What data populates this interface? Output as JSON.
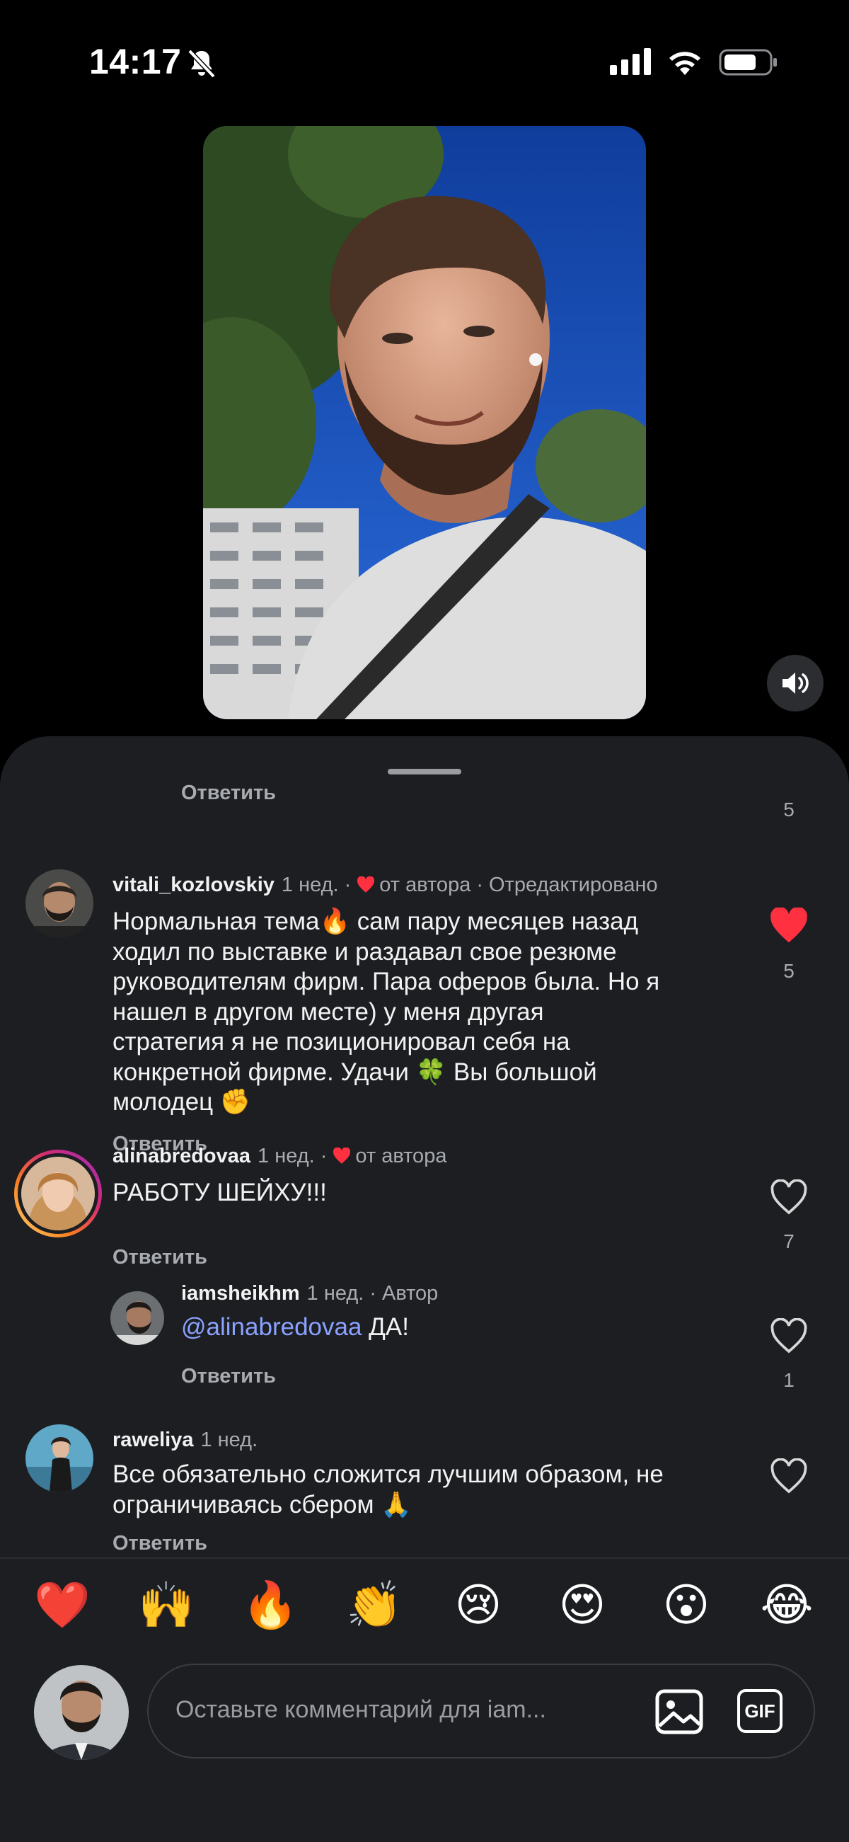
{
  "status_bar": {
    "time": "14:17"
  },
  "partial_comment": {
    "reply_label": "Ответить",
    "like_count": "5"
  },
  "comments": [
    {
      "username": "vitali_kozlovskiy",
      "time": "1 нед.",
      "liked_by_author": "от автора",
      "edited": "Отредактировано",
      "text_lines": [
        "Нормальная тема🔥 сам пару месяцев назад",
        "ходил по выставке и раздавал свое резюме",
        "руководителям фирм. Пара оферов была. Но я",
        "нашел в другом месте) у меня другая",
        "стратегия я не позиционировал себя на",
        "конкретной фирме. Удачи 🍀 Вы большой",
        "молодец ✊"
      ],
      "reply_label": "Ответить",
      "like_count": "5",
      "liked": true
    },
    {
      "username": "alinabredovaa",
      "time": "1 нед.",
      "liked_by_author": "от автора",
      "text": "РАБОТУ ШЕЙХУ!!!",
      "reply_label": "Ответить",
      "like_count": "7",
      "liked": false
    },
    {
      "username": "iamsheikhm",
      "time": "1 нед.",
      "author_badge": "Автор",
      "mention": "@alinabredovaa",
      "text": " ДА!",
      "reply_label": "Ответить",
      "like_count": "1",
      "liked": false
    },
    {
      "username": "raweliya",
      "time": "1 нед.",
      "text_lines": [
        "Все обязательно сложится лучшим образом, не",
        "ограничиваясь сбером 🙏"
      ],
      "reply_label": "Ответить",
      "liked": false
    }
  ],
  "emoji_bar": [
    "❤️",
    "🙌",
    "🔥",
    "👏",
    "😢",
    "😍",
    "😮",
    "😂"
  ],
  "comment_input": {
    "placeholder": "Оставьте комментарий для iam..."
  },
  "colors": {
    "sheet_bg": "#1c1e22",
    "like_red": "#ff3040",
    "mention": "#8aa2ff",
    "muted": "#a8abb0"
  }
}
